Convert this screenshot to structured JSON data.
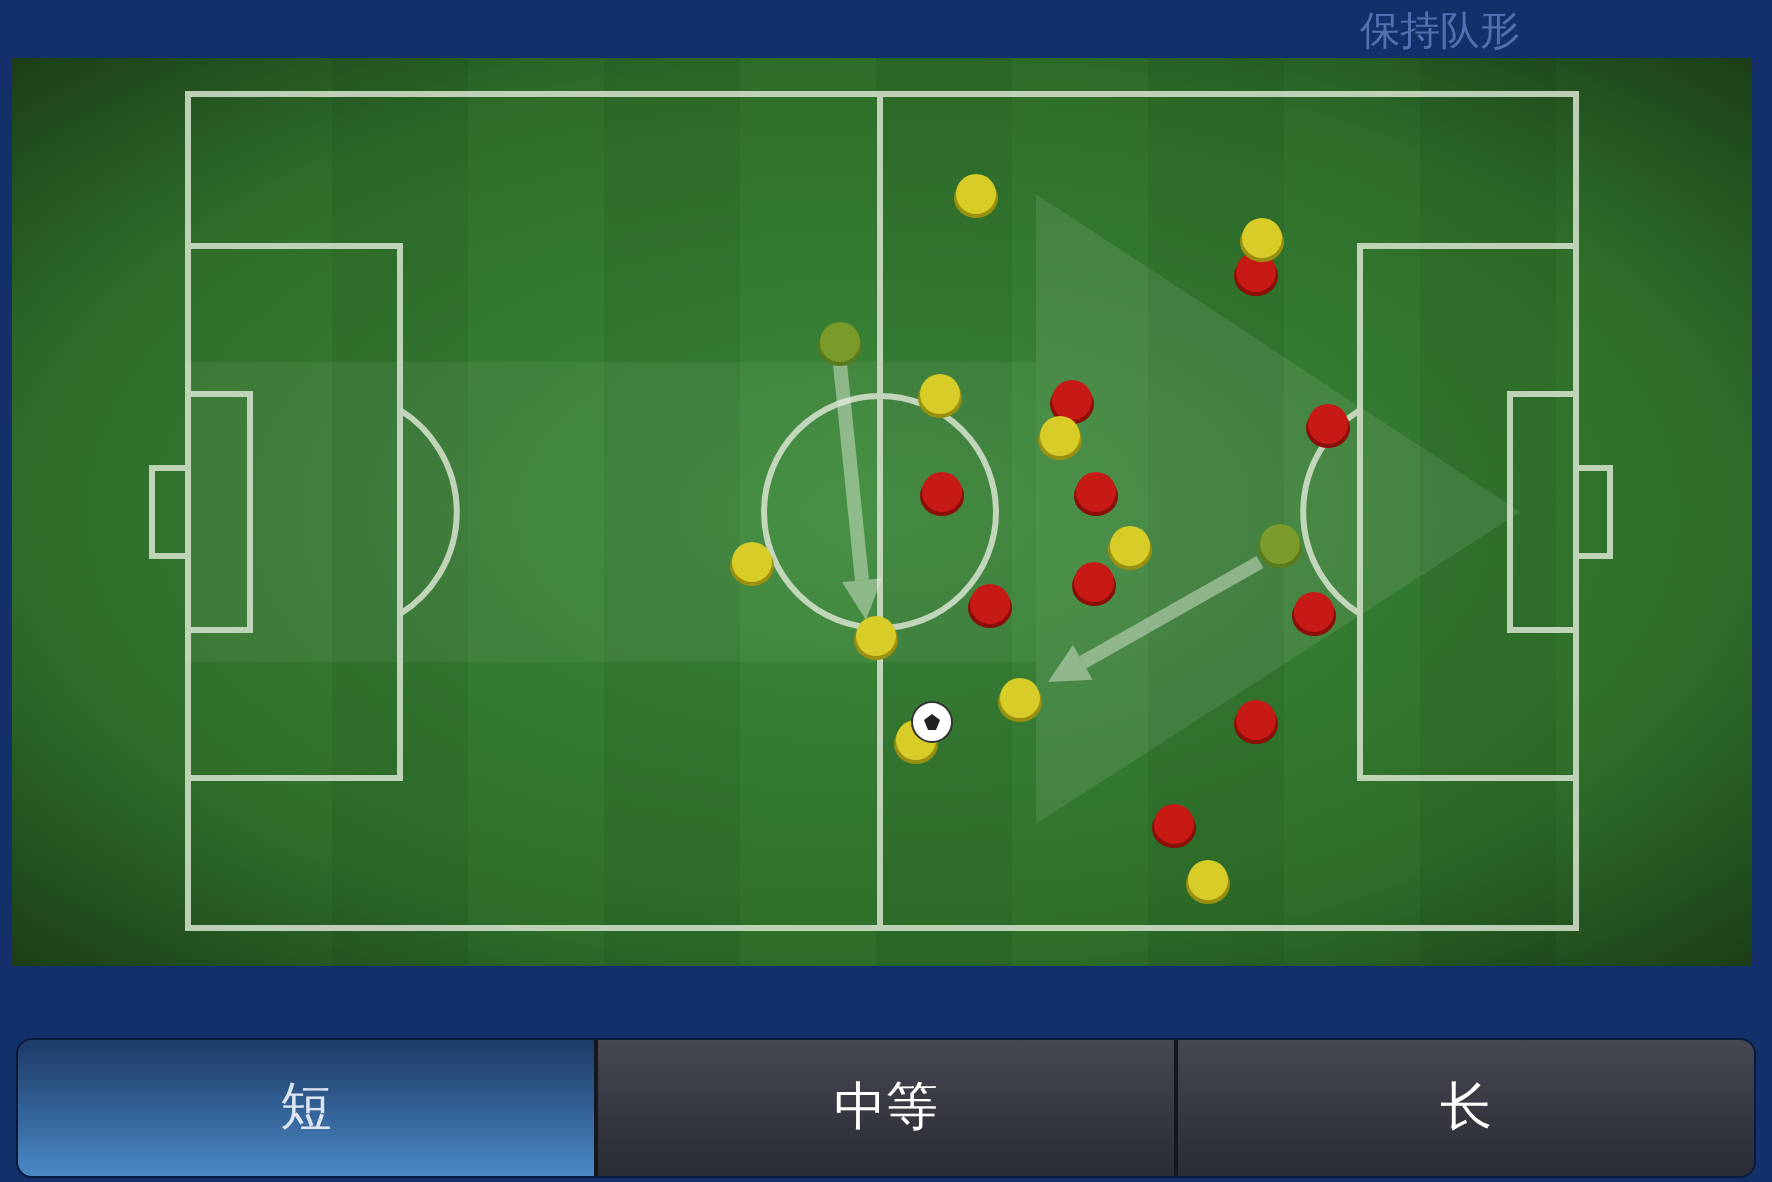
{
  "title": "保持队形",
  "tabs": [
    {
      "label": "短",
      "selected": true
    },
    {
      "label": "中等",
      "selected": false
    },
    {
      "label": "长",
      "selected": false
    }
  ]
}
